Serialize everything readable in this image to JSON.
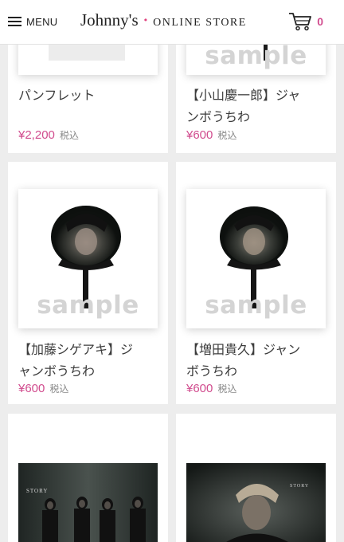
{
  "header": {
    "menu_label": "MENU",
    "logo_brand": "Johnny's",
    "logo_dot": "•",
    "logo_store": "ONLINE STORE",
    "cart_count": "0"
  },
  "products": [
    {
      "title_line1": "パンフレット",
      "title_line2": "",
      "price": "¥2,200",
      "tax": "税込",
      "watermark": ""
    },
    {
      "title_line1": "【小山慶一郎】ジャ",
      "title_line2": "ンボうちわ",
      "price": "¥600",
      "tax": "税込",
      "watermark": "sample"
    },
    {
      "title_line1": "【加藤シゲアキ】ジ",
      "title_line2": "ャンボうちわ",
      "price": "¥600",
      "tax": "税込",
      "watermark": "sample"
    },
    {
      "title_line1": "【増田貴久】ジャン",
      "title_line2": "ボうちわ",
      "price": "¥600",
      "tax": "税込",
      "watermark": "sample"
    },
    {
      "image_text": "STORY"
    },
    {
      "image_text": "STORY"
    }
  ],
  "colors": {
    "accent": "#d14c8e",
    "logo_dot": "#e0417e",
    "background": "#ededed"
  }
}
